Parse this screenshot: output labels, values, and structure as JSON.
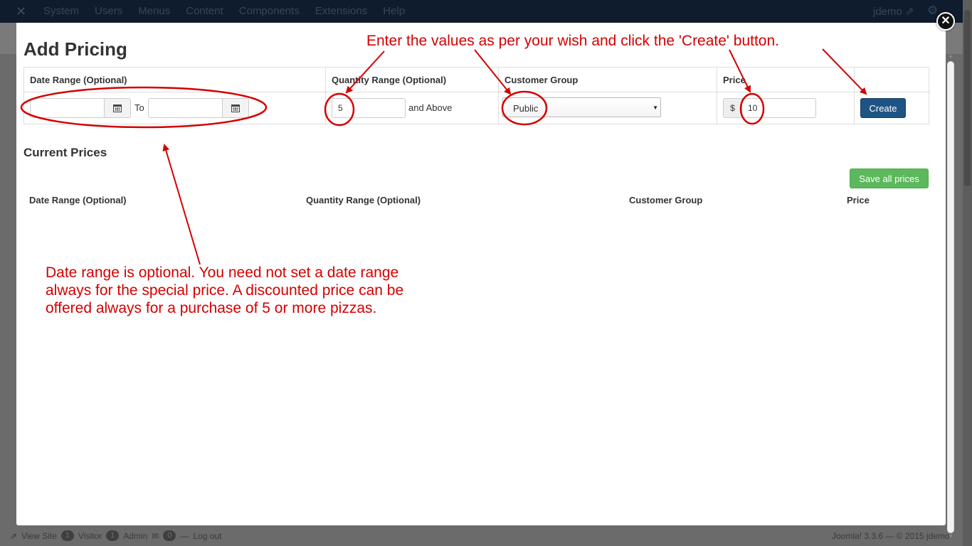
{
  "topbar": {
    "menu": [
      "System",
      "Users",
      "Menus",
      "Content",
      "Components",
      "Extensions",
      "Help"
    ],
    "user": "jdemo ⇗"
  },
  "footer": {
    "view_site": "View Site",
    "visitor_count": "1",
    "visitor_label": "Visitor",
    "admin_count": "1",
    "admin_label": "Admin",
    "messages_count": "0",
    "logout": "Log out",
    "version": "Joomla! 3.3.6 — © 2015 jdemo"
  },
  "modal": {
    "title": "Add Pricing",
    "add_table": {
      "headers": [
        "Date Range (Optional)",
        "Quantity Range (Optional)",
        "Customer Group",
        "Price"
      ],
      "date_from": "",
      "to_label": "To",
      "date_to": "",
      "quantity_value": "5",
      "and_above": "and Above",
      "customer_group": "Public",
      "currency": "$",
      "price_value": "10",
      "create_label": "Create"
    },
    "current_title": "Current Prices",
    "save_all_label": "Save all prices",
    "current_headers": [
      "Date Range (Optional)",
      "Quantity Range (Optional)",
      "Customer Group",
      "Price"
    ]
  },
  "annotations": {
    "top": "Enter the values as per your wish and click the 'Create' button.",
    "bottom_1": "Date range is optional. You need not set a date range",
    "bottom_2": "always for the special price. A discounted price can be",
    "bottom_3": "offered always for a purchase of 5 or more pizzas.",
    "color": "#d40000"
  },
  "icons": {
    "close": "close-icon",
    "calendar": "calendar-icon",
    "logo": "joomla-logo-icon",
    "gear": "gear-icon"
  }
}
